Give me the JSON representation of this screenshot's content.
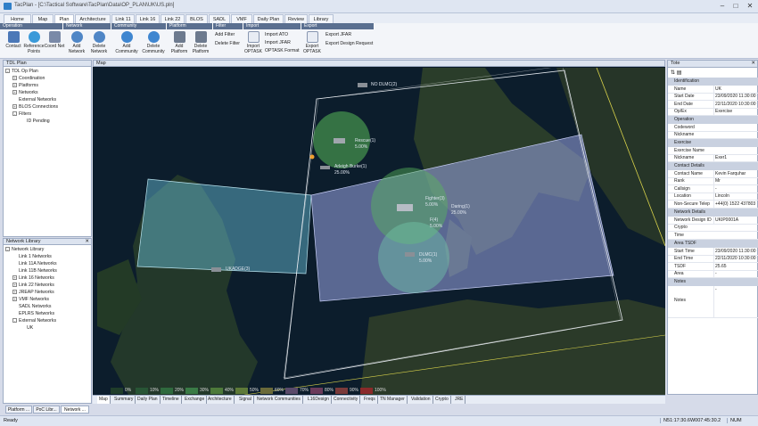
{
  "window": {
    "title": "TacPlan - [C:\\Tactical Software\\TacPlan\\Data\\OP_PLAN\\UK\\US.pln]"
  },
  "menu_tabs": [
    "Home",
    "Map",
    "Plan",
    "Architecture",
    "Link 11",
    "Link 16",
    "Link 22",
    "BLOS",
    "SADL",
    "VMF",
    "Daily Plan",
    "Review",
    "Library"
  ],
  "active_tab": "Plan",
  "ribbon": {
    "groups": [
      "Operation",
      "Network",
      "Community",
      "Platform",
      "Filter",
      "Import",
      "Export"
    ],
    "buttons": {
      "contact": "Contact",
      "reference_points": "Reference Points",
      "coord_net": "Coord Net",
      "add_network": "Add Network",
      "delete_network": "Delete Network",
      "add_community": "Add Community",
      "delete_community": "Delete Community",
      "add_platform": "Add Platform",
      "delete_platform": "Delete Platform",
      "import_optask": "Import OPTASK",
      "export_optask": "Export OPTASK"
    },
    "filter": {
      "add": "Add Filter",
      "delete": "Delete Filter"
    },
    "import": {
      "ato": "Import ATO",
      "jfar": "Import JFAR",
      "optask_format": "OPTASK Format"
    },
    "export": {
      "jfar": "Export JFAR",
      "design_request": "Export Design Request"
    }
  },
  "tdl_plan": {
    "title": "TDL Plan",
    "items": [
      "TDL Op Plan",
      "Coordination",
      "Platforms",
      "Networks",
      "External Networks",
      "BLOS Connections",
      "Filters",
      "ID Pending"
    ]
  },
  "network_library": {
    "title": "Network Library",
    "items": [
      "Network Library",
      "Link 1 Networks",
      "Link 11A Networks",
      "Link 11B Networks",
      "Link 16 Networks",
      "Link 22 Networks",
      "JREAP Networks",
      "VMF Networks",
      "SADL Networks",
      "EPLRS Networks",
      "External Networks",
      "UK"
    ]
  },
  "left_tabs": [
    "Platform ...",
    "PoC Libr...",
    "Network ..."
  ],
  "map": {
    "title": "Map",
    "labels": {
      "no_dlmc": "NO DLMC(2)",
      "rescue": "Rescue(1)",
      "rescue_pct": "5.00%",
      "arleigh": "Arleigh Burke(1)",
      "arleigh_pct": "25.00%",
      "fighter": "Fighter(3)",
      "fighter_pct": "5.00%",
      "daring": "Daring(1)",
      "daring_pct": "25.00%",
      "f4": "F(4)",
      "f4_pct": "5.00%",
      "dlmc": "DLMC(1)",
      "dlmc_pct": "5.00%",
      "ukadge": "UKADGE(3)"
    }
  },
  "legend": [
    "0%",
    "10%",
    "20%",
    "30%",
    "40%",
    "50%",
    "60%",
    "70%",
    "80%",
    "90%",
    "100%"
  ],
  "map_tabs": [
    "Map",
    "Summary",
    "Daily Plan",
    "Timeline",
    "Exchange",
    "Architecture",
    "Signal",
    "Network Communities",
    "L16Design",
    "Connectivity",
    "Freqs",
    "TN Manager",
    "Validation",
    "Crypto",
    "JRE"
  ],
  "tote": {
    "title": "Tote",
    "sections": [
      {
        "name": "Identification",
        "rows": [
          [
            "Name",
            "UK"
          ],
          [
            "Start Date",
            "23/09/2020 11:30:00"
          ],
          [
            "End Date",
            "22/11/2020 10:30:00"
          ],
          [
            "Op/Ex",
            "Exercise"
          ]
        ]
      },
      {
        "name": "Operation",
        "rows": [
          [
            "Codeword",
            ""
          ],
          [
            "Nickname",
            ""
          ]
        ]
      },
      {
        "name": "Exercise",
        "rows": [
          [
            "Exercise Name",
            ""
          ],
          [
            "Nickname",
            "Exer1"
          ]
        ]
      },
      {
        "name": "Contact Details",
        "rows": [
          [
            "Contact Name",
            "Kevin Farquhar"
          ],
          [
            "Rank",
            "Mr"
          ],
          [
            "Callsign",
            "-"
          ],
          [
            "Location",
            "Lincoln"
          ],
          [
            "Non-Secure Telep",
            "+44(0) 1522 437803"
          ]
        ]
      },
      {
        "name": "Network Details",
        "rows": [
          [
            "Network Design ID",
            "UKIP0001A"
          ],
          [
            "Crypto",
            ""
          ],
          [
            "Time",
            ""
          ]
        ]
      },
      {
        "name": "Area TSDF",
        "rows": [
          [
            "Start Time",
            "23/09/2020 11:30:00"
          ],
          [
            "End Time",
            "22/11/2020 10:30:00"
          ],
          [
            "TSDF",
            "25.65"
          ],
          [
            "Area",
            "-"
          ]
        ]
      },
      {
        "name": "Notes",
        "rows": [
          [
            "Notes",
            "-"
          ]
        ]
      }
    ]
  },
  "status": {
    "left": "Ready",
    "coords": "N51:17:30.6W007:45:30.2",
    "num": "NUM"
  },
  "colors": {
    "crypto": "#ee0000",
    "accent": "#5a6f90"
  }
}
